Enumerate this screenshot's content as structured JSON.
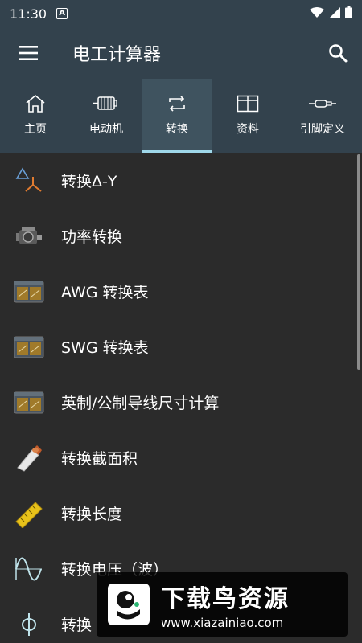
{
  "status_bar": {
    "time": "11:30",
    "notification_icon": "A"
  },
  "app_bar": {
    "title": "电工计算器",
    "menu_icon": "hamburger-menu-icon",
    "search_icon": "search-icon"
  },
  "tabs": [
    {
      "label": "主页",
      "icon": "home-icon",
      "active": false
    },
    {
      "label": "电动机",
      "icon": "motor-icon",
      "active": false
    },
    {
      "label": "转换",
      "icon": "convert-icon",
      "active": true
    },
    {
      "label": "资料",
      "icon": "table-icon",
      "active": false
    },
    {
      "label": "引脚定义",
      "icon": "connector-icon",
      "active": false
    }
  ],
  "accent_colors": {
    "header_bg": "#33424d",
    "active_tab_indicator": "#9fd8ea",
    "list_bg": "#2b2b2b"
  },
  "list_items": [
    {
      "label": "转换Δ-Y",
      "icon": "delta-star-icon"
    },
    {
      "label": "功率转换",
      "icon": "engine-icon"
    },
    {
      "label": "AWG 转换表",
      "icon": "awg-table-icon"
    },
    {
      "label": "SWG 转换表",
      "icon": "swg-table-icon"
    },
    {
      "label": "英制/公制导线尺寸计算",
      "icon": "wire-size-icon"
    },
    {
      "label": "转换截面积",
      "icon": "cable-cross-section-icon"
    },
    {
      "label": "转换长度",
      "icon": "ruler-icon"
    },
    {
      "label": "转换电压（波）",
      "icon": "sine-wave-icon"
    },
    {
      "label": "转换",
      "icon": "phi-icon"
    }
  ],
  "watermark": {
    "title": "下载鸟资源",
    "url": "www.xiazainiao.com"
  }
}
